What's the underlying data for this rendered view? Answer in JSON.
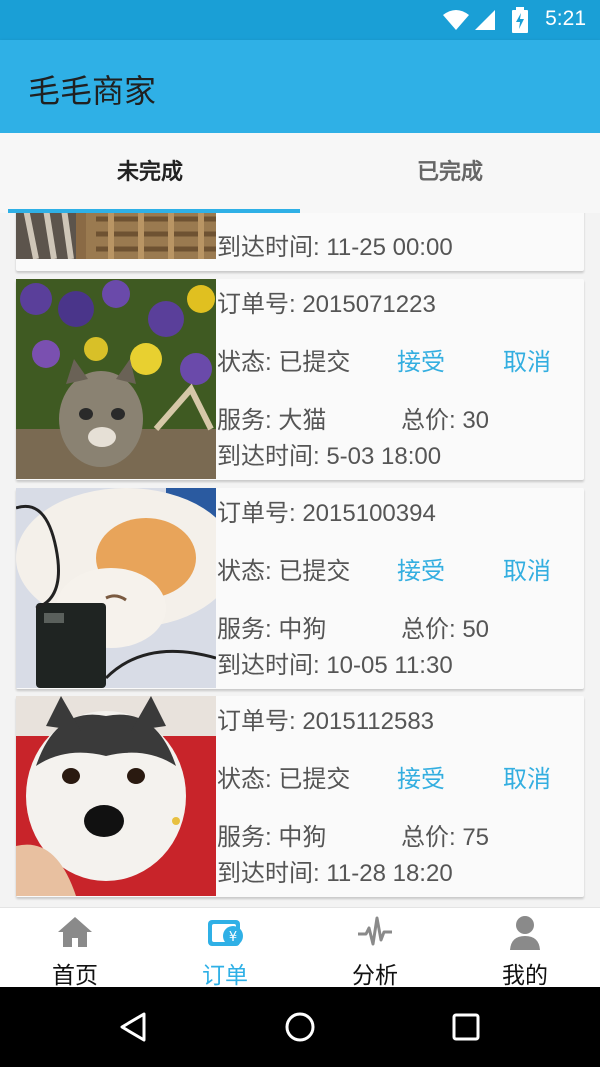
{
  "status_bar": {
    "time": "5:21"
  },
  "app_bar": {
    "title": "毛毛商家"
  },
  "tabs": [
    {
      "label": "未完成",
      "active": true
    },
    {
      "label": "已完成",
      "active": false
    }
  ],
  "orders": [
    {
      "partial": true,
      "arrival": "到达时间: 11-25 00:00"
    },
    {
      "order_no": "订单号: 2015071223",
      "status": "状态: 已提交",
      "accept": "接受",
      "cancel": "取消",
      "service": "服务: 大猫",
      "total": "总价: 30",
      "arrival": "到达时间: 5-03 18:00"
    },
    {
      "order_no": "订单号: 2015100394",
      "status": "状态: 已提交",
      "accept": "接受",
      "cancel": "取消",
      "service": "服务: 中狗",
      "total": "总价: 50",
      "arrival": "到达时间: 10-05 11:30"
    },
    {
      "order_no": "订单号: 2015112583",
      "status": "状态: 已提交",
      "accept": "接受",
      "cancel": "取消",
      "service": "服务: 中狗",
      "total": "总价: 75",
      "arrival": "到达时间: 11-28 18:20"
    }
  ],
  "bottom_nav": [
    {
      "label": "首页",
      "icon": "home-icon",
      "active": false
    },
    {
      "label": "订单",
      "icon": "order-wallet-icon",
      "active": true
    },
    {
      "label": "分析",
      "icon": "pulse-icon",
      "active": false
    },
    {
      "label": "我的",
      "icon": "person-icon",
      "active": false
    }
  ],
  "colors": {
    "primary": "#2fb0e6",
    "status_bar": "#1a9fd6",
    "accent_text": "#33aee0"
  }
}
